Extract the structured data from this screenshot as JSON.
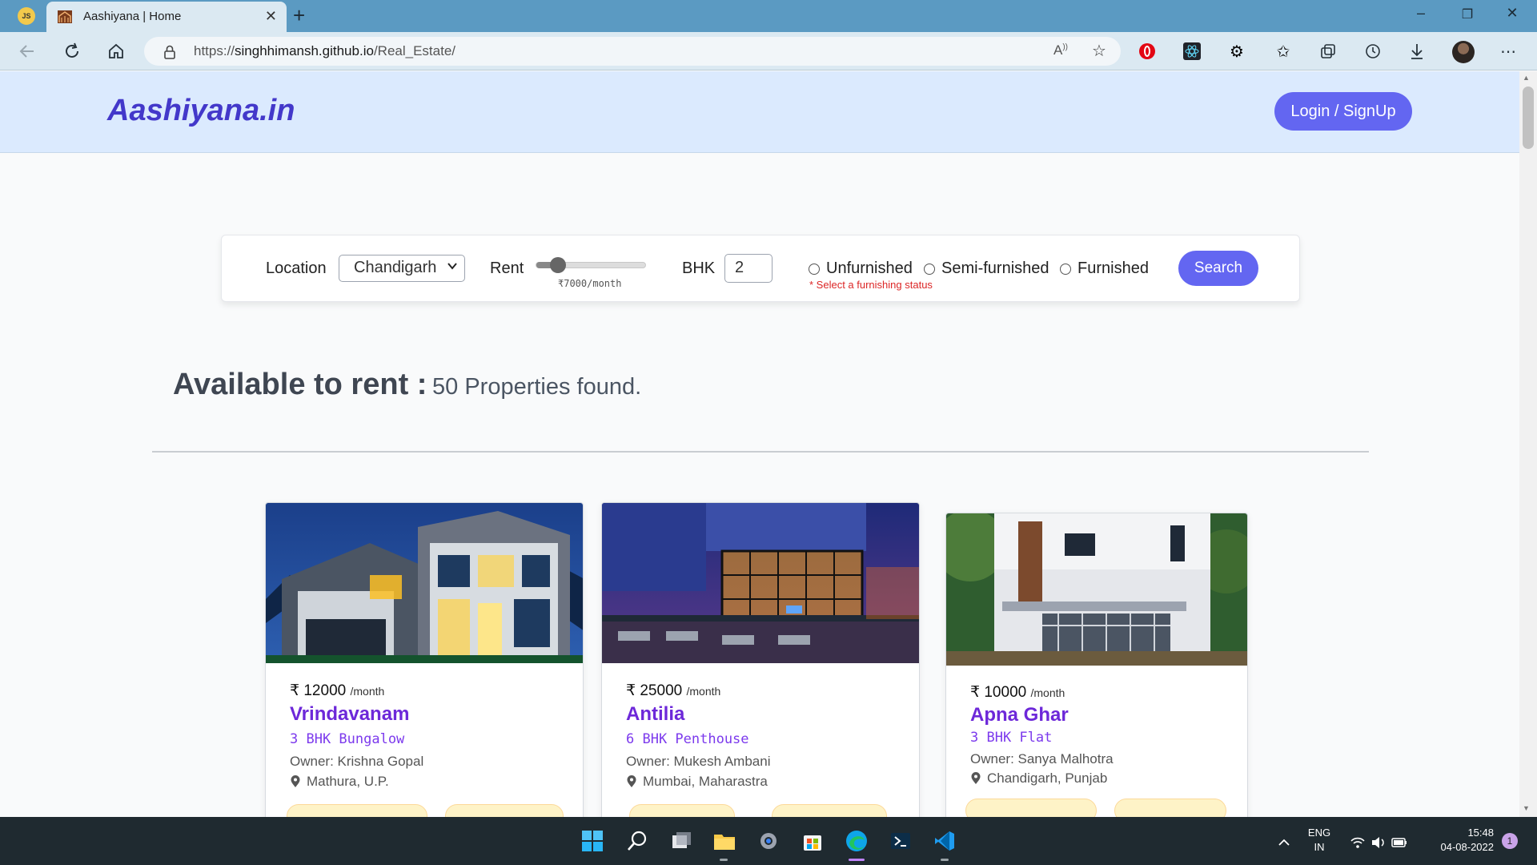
{
  "browser": {
    "profile_initials": "JS",
    "tab_title": "Aashiyana | Home",
    "url_prefix": "https://",
    "url_host": "singhhimansh.github.io",
    "url_path": "/Real_Estate/"
  },
  "header": {
    "logo": "Aashiyana.in",
    "login_label": "Login / SignUp"
  },
  "search": {
    "location_label": "Location",
    "location_value": "Chandigarh",
    "rent_label": "Rent",
    "rent_value": "₹7000/month",
    "rent_slider_fraction": 0.2,
    "bhk_label": "BHK",
    "bhk_value": "2",
    "furnishing_options": [
      "Unfurnished",
      "Semi-furnished",
      "Furnished"
    ],
    "furnishing_error": "* Select a furnishing status",
    "search_label": "Search"
  },
  "listing": {
    "title": "Available to rent :",
    "count_text": "50 Properties found."
  },
  "properties": [
    {
      "price": "₹ 12000",
      "per": "/month",
      "name": "Vrindavanam",
      "type": "3 BHK Bungalow",
      "owner": "Owner: Krishna Gopal",
      "location": "Mathura, U.P."
    },
    {
      "price": "₹ 25000",
      "per": "/month",
      "name": "Antilia",
      "type": "6 BHK Penthouse",
      "owner": "Owner: Mukesh Ambani",
      "location": "Mumbai, Maharastra"
    },
    {
      "price": "₹ 10000",
      "per": "/month",
      "name": "Apna Ghar",
      "type": "3 BHK Flat",
      "owner": "Owner: Sanya Malhotra",
      "location": "Chandigarh, Punjab"
    }
  ],
  "taskbar": {
    "lang_top": "ENG",
    "lang_bottom": "IN",
    "time": "15:48",
    "date": "04-08-2022",
    "notification_count": "1"
  }
}
